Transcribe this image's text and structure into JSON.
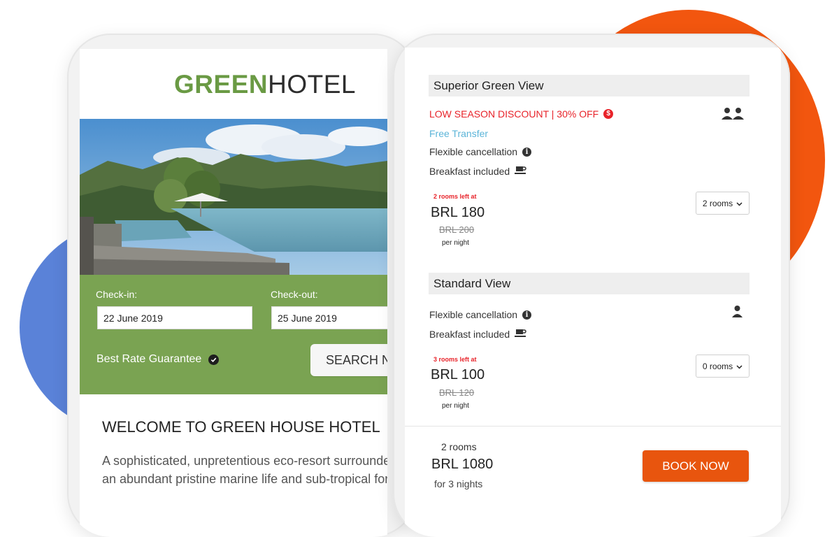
{
  "colors": {
    "brand_green": "#6a9a44",
    "form_green": "#7aa352",
    "discount_red": "#e8232a",
    "transfer_blue": "#5bb4d8",
    "book_orange": "#e8550e",
    "background_blob_blue": "#5a82d8",
    "background_blob_orange": "#f2560f"
  },
  "left_phone": {
    "logo": {
      "green": "GREEN",
      "hotel": "HOTEL"
    },
    "hero_image": "resort-infinity-pool-photo",
    "form": {
      "checkin_label": "Check-in:",
      "checkin_value": "22 June 2019",
      "checkout_label": "Check-out:",
      "checkout_value": "25 June 2019",
      "best_rate": "Best Rate Guarantee",
      "best_rate_icon": "check-circle-icon",
      "search_label": "SEARCH NOW"
    },
    "welcome_title": "WELCOME TO GREEN HOUSE HOTEL",
    "description_line1": "A sophisticated, unpretentious eco-resort surrounded by",
    "description_line2": "an abundant pristine marine life and sub-tropical forest."
  },
  "right_phone": {
    "rooms": [
      {
        "name": "Superior Green View",
        "discount": "LOW SEASON DISCOUNT | 30% OFF",
        "transfer": "Free Transfer",
        "cancellation": "Flexible cancellation",
        "breakfast": "Breakfast included",
        "occupancy_icon": "two-persons-icon",
        "rooms_left": "2 rooms left at",
        "price": "BRL 180",
        "old_price": "BRL 200",
        "per_night": "per night",
        "rooms_select": "2 rooms"
      },
      {
        "name": "Standard View",
        "cancellation": "Flexible cancellation",
        "breakfast": "Breakfast included",
        "occupancy_icon": "person-icon",
        "rooms_left": "3 rooms left at",
        "price": "BRL 100",
        "old_price": "BRL 120",
        "per_night": "per night",
        "rooms_select": "0 rooms"
      }
    ],
    "summary": {
      "rooms": "2 rooms",
      "total": "BRL 1080",
      "nights": "for 3 nights",
      "book_label": "BOOK NOW"
    }
  }
}
